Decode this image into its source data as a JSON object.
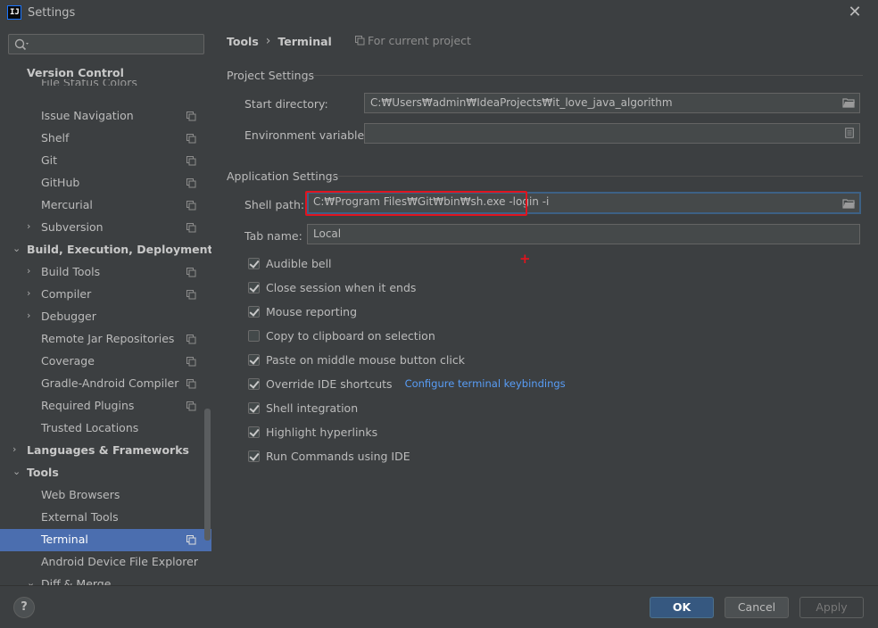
{
  "window": {
    "app_logo": "IJ",
    "title": "Settings",
    "close_glyph": "✕"
  },
  "sidebar": {
    "search_placeholder": "",
    "clipped_item": "File Status Colors",
    "section_header": "Version Control",
    "items": [
      {
        "label": "Issue Navigation",
        "level": 1,
        "arrow": "",
        "project": true
      },
      {
        "label": "Shelf",
        "level": 1,
        "arrow": "",
        "project": true
      },
      {
        "label": "Git",
        "level": 1,
        "arrow": "",
        "project": true
      },
      {
        "label": "GitHub",
        "level": 1,
        "arrow": "",
        "project": true
      },
      {
        "label": "Mercurial",
        "level": 1,
        "arrow": "",
        "project": true
      },
      {
        "label": "Subversion",
        "level": 1,
        "arrow": "›",
        "project": true
      },
      {
        "label": "Build, Execution, Deployment",
        "level": 0,
        "arrow": "⌄",
        "project": false,
        "bold": true
      },
      {
        "label": "Build Tools",
        "level": 1,
        "arrow": "›",
        "project": true
      },
      {
        "label": "Compiler",
        "level": 1,
        "arrow": "›",
        "project": true
      },
      {
        "label": "Debugger",
        "level": 1,
        "arrow": "›",
        "project": false
      },
      {
        "label": "Remote Jar Repositories",
        "level": 1,
        "arrow": "",
        "project": true
      },
      {
        "label": "Coverage",
        "level": 1,
        "arrow": "",
        "project": true
      },
      {
        "label": "Gradle-Android Compiler",
        "level": 1,
        "arrow": "",
        "project": true
      },
      {
        "label": "Required Plugins",
        "level": 1,
        "arrow": "",
        "project": true
      },
      {
        "label": "Trusted Locations",
        "level": 1,
        "arrow": "",
        "project": false
      },
      {
        "label": "Languages & Frameworks",
        "level": 0,
        "arrow": "›",
        "project": false,
        "bold": true
      },
      {
        "label": "Tools",
        "level": 0,
        "arrow": "⌄",
        "project": false,
        "bold": true
      },
      {
        "label": "Web Browsers",
        "level": 1,
        "arrow": "",
        "project": false
      },
      {
        "label": "External Tools",
        "level": 1,
        "arrow": "",
        "project": false
      },
      {
        "label": "Terminal",
        "level": 1,
        "arrow": "",
        "project": true,
        "selected": true
      },
      {
        "label": "Android Device File Explorer",
        "level": 1,
        "arrow": "",
        "project": false
      },
      {
        "label": "Diff & Merge",
        "level": 1,
        "arrow": "⌄",
        "project": false
      }
    ]
  },
  "header": {
    "crumb_parent": "Tools",
    "crumb_sep": "›",
    "crumb_current": "Terminal",
    "scope": "For current project"
  },
  "project_settings": {
    "title": "Project Settings",
    "start_dir_label": "Start directory:",
    "start_dir_value": "C:₩Users₩admin₩IdeaProjects₩it_love_java_algorithm",
    "env_label": "Environment variables:",
    "env_value": ""
  },
  "app_settings": {
    "title": "Application Settings",
    "shell_label": "Shell path:",
    "shell_value": "C:₩Program Files₩Git₩bin₩sh.exe -login -i",
    "tab_label": "Tab name:",
    "tab_value": "Local",
    "checkboxes": [
      {
        "label": "Audible bell",
        "checked": true
      },
      {
        "label": "Close session when it ends",
        "checked": true
      },
      {
        "label": "Mouse reporting",
        "checked": true
      },
      {
        "label": "Copy to clipboard on selection",
        "checked": false
      },
      {
        "label": "Paste on middle mouse button click",
        "checked": true
      },
      {
        "label": "Override IDE shortcuts",
        "checked": true
      },
      {
        "label": "Shell integration",
        "checked": true
      },
      {
        "label": "Highlight hyperlinks",
        "checked": true
      },
      {
        "label": "Run Commands using IDE",
        "checked": true
      }
    ],
    "keybindings_link": "Configure terminal keybindings"
  },
  "footer": {
    "help": "?",
    "ok": "OK",
    "cancel": "Cancel",
    "apply": "Apply"
  },
  "colors": {
    "selection": "#4b6eaf",
    "highlight": "#e0141e",
    "primary_button": "#365880",
    "link": "#589df6"
  }
}
